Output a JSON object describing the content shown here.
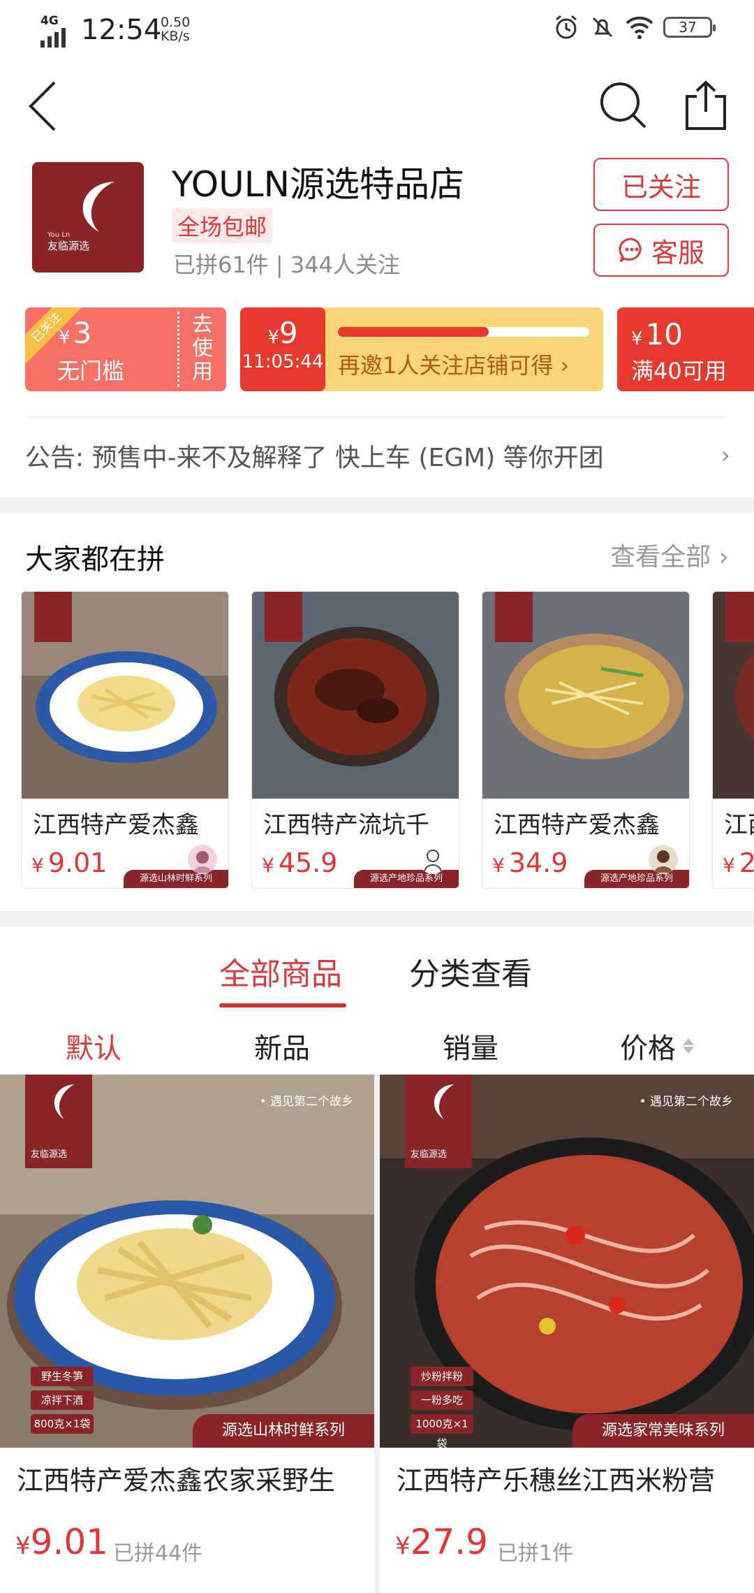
{
  "status_bar": {
    "network": "4G",
    "time": "12:54",
    "speed_value": "0.50",
    "speed_unit": "KB/s",
    "battery": "37"
  },
  "store": {
    "logo_text": "友临源选",
    "logo_sub": "You Ln",
    "name": "YOULN源选特品店",
    "tag": "全场包邮",
    "stats": "已拼61件 | 344人关注",
    "follow_label": "已关注",
    "service_label": "客服"
  },
  "coupons": {
    "c1": {
      "ribbon": "已关注",
      "currency": "¥",
      "amount": "3",
      "condition": "无门槛",
      "claim": "去使用"
    },
    "c2": {
      "currency": "¥",
      "amount": "9",
      "timer": "11:05:44",
      "progress": 0.6,
      "text": "再邀1人关注店铺可得 ›"
    },
    "c3": {
      "currency": "¥",
      "amount": "10",
      "condition": "满40可用"
    }
  },
  "notice": {
    "text": "公告: 预售中-来不及解释了 快上车 (EGM) 等你开团",
    "chevron": "›"
  },
  "group": {
    "title": "大家都在拼",
    "more": "查看全部 ›",
    "items": [
      {
        "name": "江西特产爱杰鑫",
        "currency": "¥",
        "price": "9.01",
        "band": "源选山林时鲜系列"
      },
      {
        "name": "江西特产流坑千",
        "currency": "¥",
        "price": "45.9",
        "band": "源选产地珍品系列"
      },
      {
        "name": "江西特产爱杰鑫",
        "currency": "¥",
        "price": "34.9",
        "band": "源选产地珍品系列"
      },
      {
        "name": "江西",
        "currency": "¥",
        "price": "2"
      }
    ]
  },
  "tabs": {
    "all": "全部商品",
    "category": "分类查看"
  },
  "sort": {
    "default": "默认",
    "new": "新品",
    "sales": "销量",
    "price": "价格"
  },
  "products": [
    {
      "name": "江西特产爱杰鑫农家采野生",
      "currency": "¥",
      "price": "9.01",
      "sold": "已拼44件",
      "tagline": "• 遇见第二个故乡",
      "band": "源选山林时鲜系列",
      "chips": [
        "野生冬笋",
        "凉拌下酒",
        "800克×1袋"
      ]
    },
    {
      "name": "江西特产乐穗丝江西米粉营",
      "currency": "¥",
      "price": "27.9",
      "sold": "已拼1件",
      "tagline": "• 遇见第二个故乡",
      "band": "源选家常美味系列",
      "chips": [
        "炒粉拌粉",
        "一粉多吃",
        "1000克×1袋"
      ]
    }
  ],
  "colors": {
    "brand_red": "#d93a3f",
    "logo_maroon": "#8a2429",
    "coupon_salmon": "#f77068",
    "coupon_yellow": "#fbd679"
  }
}
